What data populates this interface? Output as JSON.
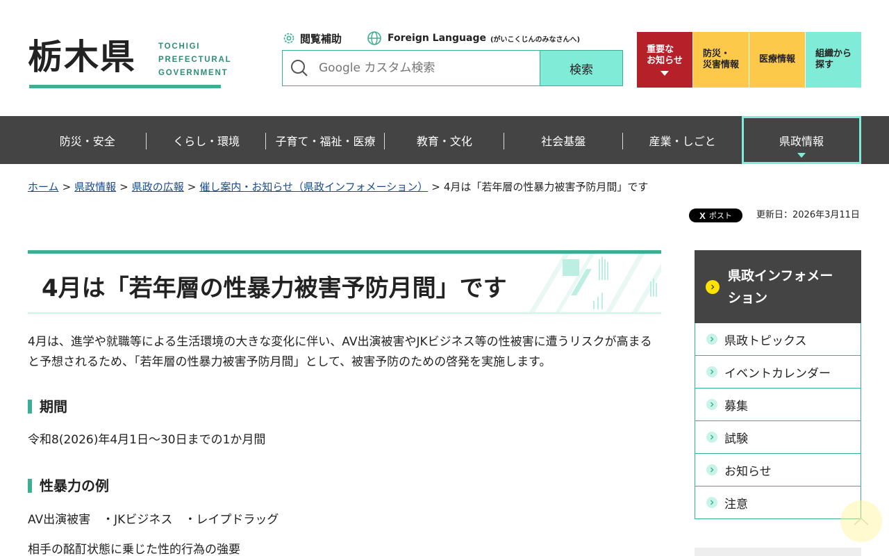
{
  "header": {
    "logo_kanji": "栃木県",
    "logo_en_1": "TOCHIGI",
    "logo_en_2": "PREFECTURAL",
    "logo_en_3": "GOVERNMENT",
    "assist_label": "閲覧補助",
    "foreign_label": "Foreign Language",
    "foreign_sub": "(がいこくじんのみなさんへ)",
    "search_placeholder": "Google カスタム検索",
    "search_button": "検索",
    "quick_links": [
      {
        "label": "重要な\nお知らせ"
      },
      {
        "label": "防災・\n災害情報"
      },
      {
        "label": "医療情報"
      },
      {
        "label": "組織から\n探す"
      }
    ]
  },
  "nav": {
    "items": [
      "防災・安全",
      "くらし・環境",
      "子育て・福祉・医療",
      "教育・文化",
      "社会基盤",
      "産業・しごと",
      "県政情報"
    ]
  },
  "breadcrumb": {
    "items": [
      "ホーム",
      "県政情報",
      "県政の広報",
      "催し案内・お知らせ（県政インフォメーション）"
    ],
    "current": "4月は「若年層の性暴力被害予防月間」です"
  },
  "share": {
    "post_label": "ポスト",
    "x_glyph": "X"
  },
  "updated": "更新日：2026年3月11日",
  "main": {
    "title": "4月は「若年層の性暴力被害予防月間」です",
    "lead": "4月は、進学や就職等による生活環境の大きな変化に伴い、AV出演被害やJKビジネス等の性被害に遭うリスクが高まると予想されるため、「若年層の性暴力被害予防月間」として、被害予防のための啓発を実施します。",
    "period_heading": "期間",
    "period_text": "令和8(2026)年4月1日～30日までの1か月間",
    "examples_heading": "性暴力の例",
    "examples_line1": "AV出演被害　・JKビジネス　・レイプドラッグ",
    "examples_line2": "相手の酩酊状態に乗じた性的行為の強要"
  },
  "side": {
    "heading": "県政インフォメーション",
    "items": [
      "県政トピックス",
      "イベントカレンダー",
      "募集",
      "試験",
      "お知らせ",
      "注意"
    ]
  },
  "colors": {
    "accent": "#3cae92",
    "mint": "#80ebd6",
    "nav_bg": "#444444",
    "alert_red": "#b52029",
    "yellow": "#fcc94b"
  }
}
